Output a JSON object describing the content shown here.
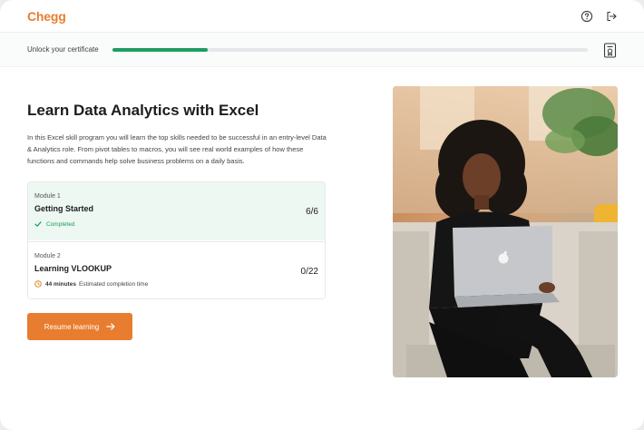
{
  "header": {
    "logo": "Chegg",
    "help_icon": "help-circle-icon",
    "logout_icon": "logout-icon"
  },
  "progress": {
    "label": "Unlock your certificate",
    "fraction": 0.2,
    "certificate_icon": "certificate-icon",
    "fill_color": "#1e9c5e"
  },
  "course": {
    "title": "Learn Data Analytics with Excel",
    "description": "In this Excel skill program you will learn the top skills needed to be successful in an entry-level Data & Analytics role. From pivot tables to macros, you will see real world examples of how these functions and commands help solve business problems on a daily basis."
  },
  "modules": [
    {
      "number": "Module 1",
      "title": "Getting Started",
      "count": "6/6",
      "status": "Completed"
    },
    {
      "number": "Module 2",
      "title": "Learning VLOOKUP",
      "count": "0/22",
      "time_value": "44 minutes",
      "time_label": "Estimated completion time"
    }
  ],
  "cta": {
    "label": "Resume learning",
    "color": "#e87d2f"
  },
  "hero_image": {
    "subject": "woman-with-laptop-photo"
  }
}
